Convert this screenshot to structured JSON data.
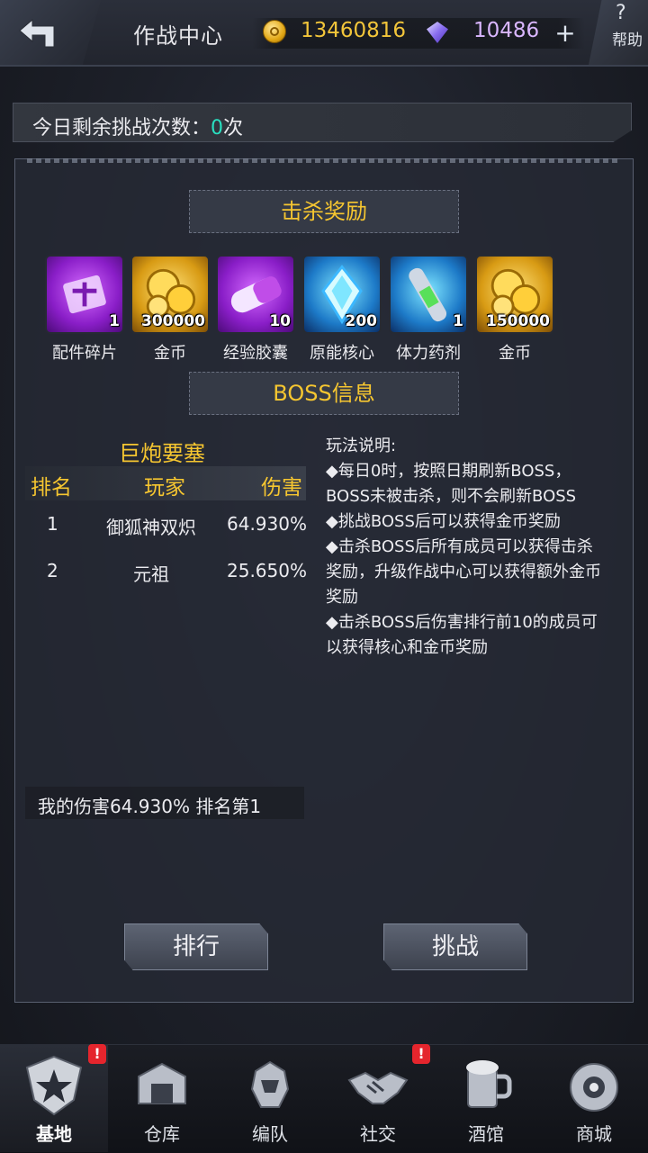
{
  "header": {
    "title": "作战中心",
    "gold": "13460816",
    "gems": "10486",
    "plus": "+",
    "help_symbol": "?",
    "help_label": "帮助"
  },
  "challenge": {
    "label": "今日剩余挑战次数：",
    "count": "0",
    "unit": "次"
  },
  "kill_reward": {
    "title": "击杀奖励",
    "items": [
      {
        "name": "配件碎片",
        "qty": "1",
        "color": "purple"
      },
      {
        "name": "金币",
        "qty": "300000",
        "color": "gold"
      },
      {
        "name": "经验胶囊",
        "qty": "10",
        "color": "purple"
      },
      {
        "name": "原能核心",
        "qty": "200",
        "color": "blue"
      },
      {
        "name": "体力药剂",
        "qty": "1",
        "color": "blue"
      },
      {
        "name": "金币",
        "qty": "150000",
        "color": "gold"
      }
    ]
  },
  "boss_info": {
    "title": "BOSS信息",
    "boss_name": "巨炮要塞",
    "columns": [
      "排名",
      "玩家",
      "伤害"
    ],
    "rows": [
      {
        "rank": "1",
        "player": "御狐神双炽",
        "damage": "64.930%"
      },
      {
        "rank": "2",
        "player": "元祖",
        "damage": "25.650%"
      }
    ],
    "my_damage": "我的伤害64.930%    排名第1"
  },
  "rules": {
    "title": "玩法说明:",
    "lines": [
      "◆每日0时，按照日期刷新BOSS，BOSS未被击杀，则不会刷新BOSS",
      "◆挑战BOSS后可以获得金币奖励",
      "◆击杀BOSS后所有成员可以获得击杀奖励，升级作战中心可以获得额外金币奖励",
      "◆击杀BOSS后伤害排行前10的成员可以获得核心和金币奖励"
    ]
  },
  "buttons": {
    "rank": "排行",
    "challenge": "挑战"
  },
  "nav": {
    "items": [
      {
        "label": "基地",
        "icon": "base-emblem-icon",
        "badge": "!"
      },
      {
        "label": "仓库",
        "icon": "warehouse-icon",
        "badge": ""
      },
      {
        "label": "编队",
        "icon": "squad-icon",
        "badge": ""
      },
      {
        "label": "社交",
        "icon": "handshake-icon",
        "badge": "!"
      },
      {
        "label": "酒馆",
        "icon": "tavern-mug-icon",
        "badge": ""
      },
      {
        "label": "商城",
        "icon": "shop-icon",
        "badge": ""
      }
    ]
  },
  "colors": {
    "accent_gold": "#f6c630",
    "count_teal": "#29e0c0",
    "badge_red": "#e5252d"
  }
}
